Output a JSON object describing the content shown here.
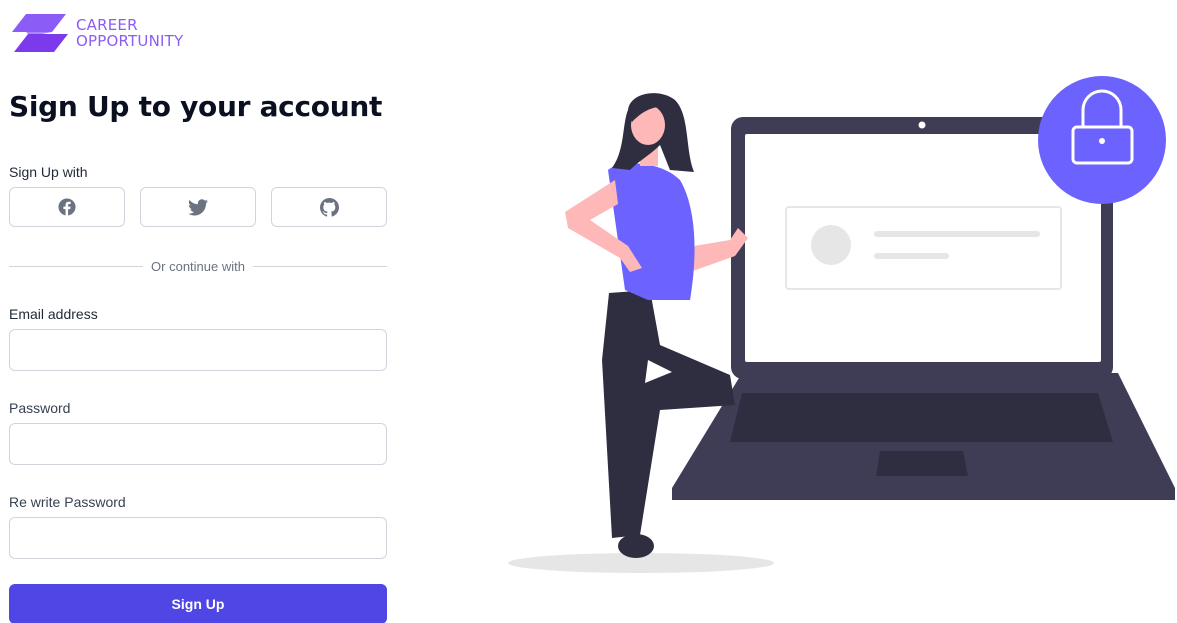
{
  "brand": {
    "line1": "CAREER",
    "line2": "OPPORTUNITY",
    "color": "#8b5cf6"
  },
  "form": {
    "title": "Sign Up to your account",
    "sign_up_with_label": "Sign Up with",
    "social": [
      {
        "name": "facebook",
        "icon": "facebook-icon"
      },
      {
        "name": "twitter",
        "icon": "twitter-icon"
      },
      {
        "name": "github",
        "icon": "github-icon"
      }
    ],
    "divider_text": "Or continue with",
    "email_label": "Email address",
    "email_value": "",
    "password_label": "Password",
    "password_value": "",
    "rewrite_password_label": "Re write Password",
    "rewrite_password_value": "",
    "submit_label": "Sign Up",
    "accent_color": "#4f46e5"
  },
  "illustration": {
    "name": "woman-with-laptop-lock",
    "accent_color": "#6c63ff",
    "laptop_color": "#3f3d56"
  }
}
